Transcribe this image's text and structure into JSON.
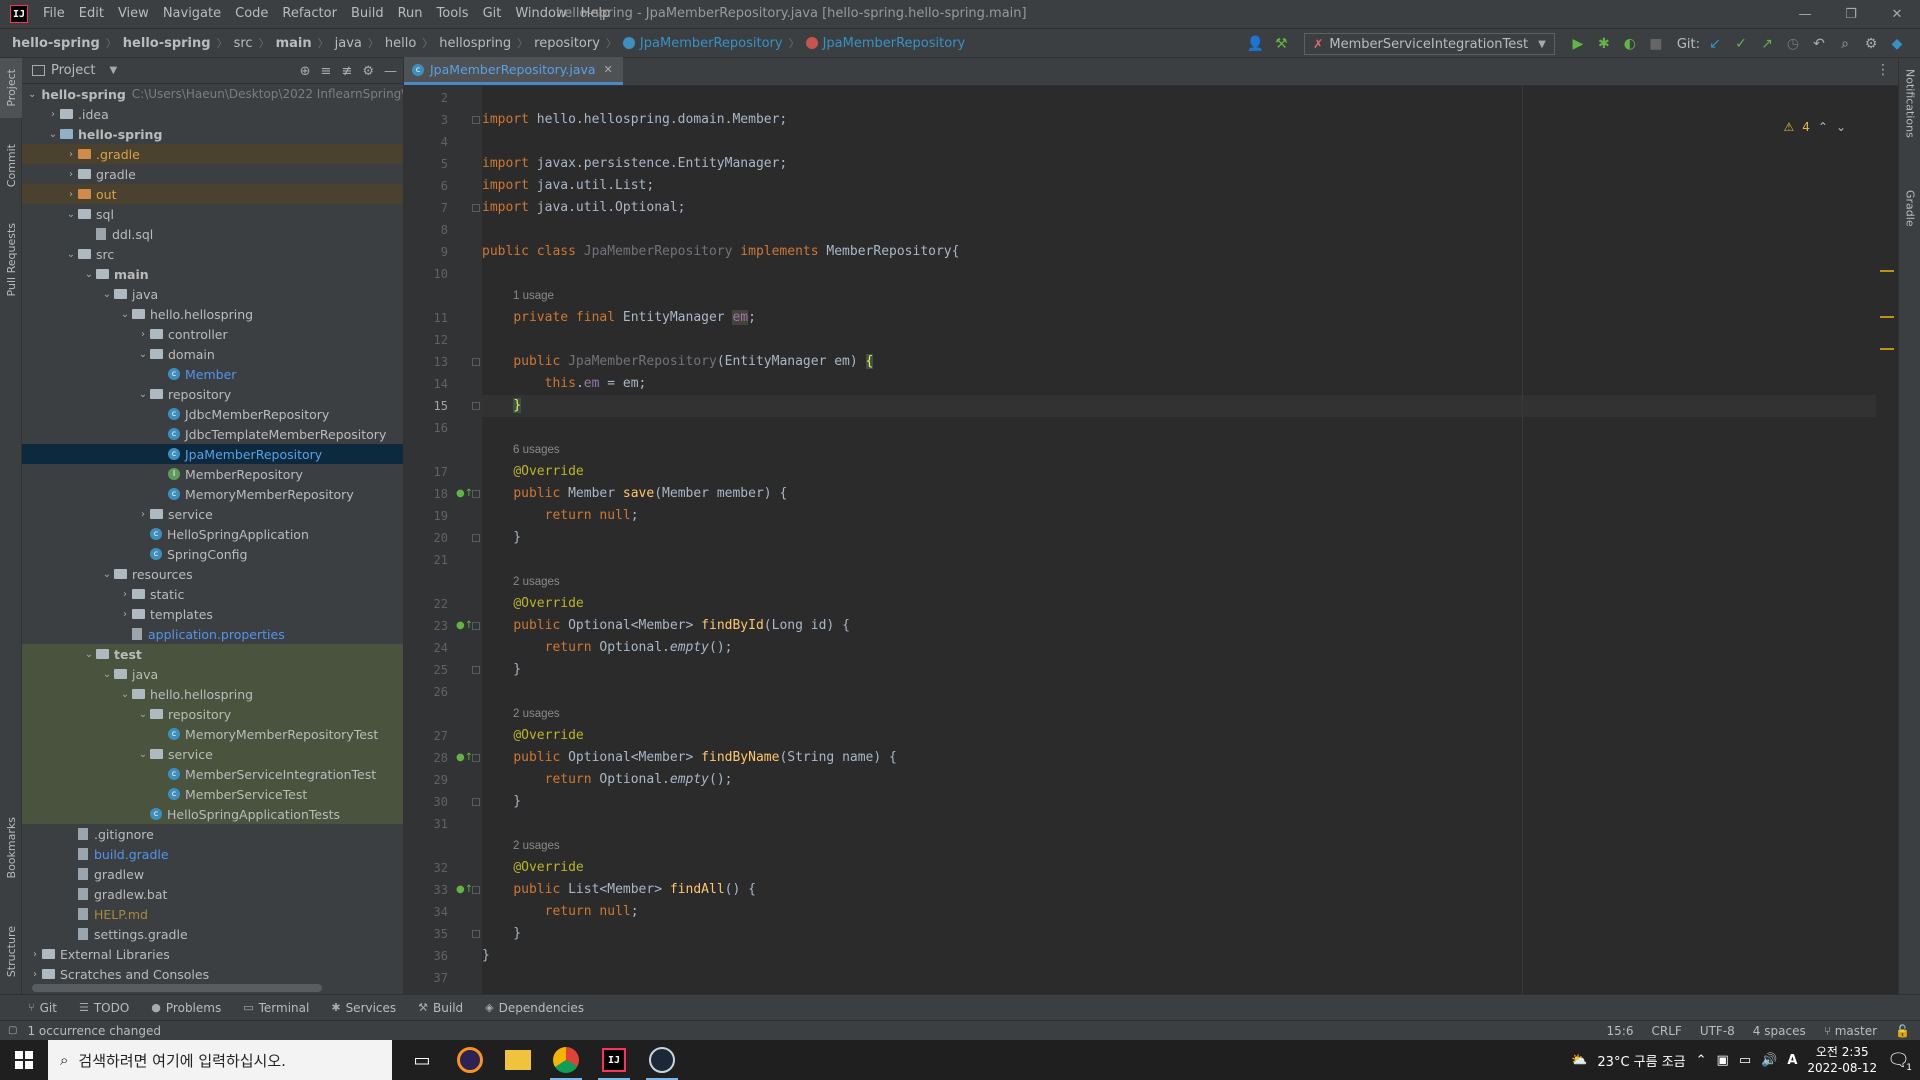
{
  "menu": {
    "logo": "IJ",
    "items": [
      "File",
      "Edit",
      "View",
      "Navigate",
      "Code",
      "Refactor",
      "Build",
      "Run",
      "Tools",
      "Git",
      "Window",
      "Help"
    ]
  },
  "window_title": "hello-spring - JpaMemberRepository.java [hello-spring.hello-spring.main]",
  "breadcrumb": [
    "hello-spring",
    "hello-spring",
    "src",
    "main",
    "java",
    "hello",
    "hellospring",
    "repository",
    "JpaMemberRepository",
    "JpaMemberRepository"
  ],
  "run_config": "MemberServiceIntegrationTest",
  "git_label": "Git:",
  "left_tabs": [
    "Project",
    "Commit",
    "Pull Requests",
    "Bookmarks",
    "Structure"
  ],
  "right_tabs": [
    "Notifications",
    "Gradle"
  ],
  "project_panel": {
    "title": "Project",
    "root_path": "C:\\Users\\Haeun\\Desktop\\2022 InflearnSpring\\"
  },
  "tree": [
    {
      "label": "hello-spring",
      "depth": 0,
      "type": "module",
      "arrow": "open",
      "bold": true
    },
    {
      "label": ".idea",
      "depth": 1,
      "type": "folder",
      "arrow": "closed"
    },
    {
      "label": "hello-spring",
      "depth": 1,
      "type": "module",
      "arrow": "open",
      "bold": true
    },
    {
      "label": ".gradle",
      "depth": 2,
      "type": "folder-orange",
      "arrow": "closed",
      "color": "orange",
      "hl": "brown"
    },
    {
      "label": "gradle",
      "depth": 2,
      "type": "folder",
      "arrow": "closed"
    },
    {
      "label": "out",
      "depth": 2,
      "type": "folder-orange",
      "arrow": "closed",
      "color": "orange",
      "hl": "brown"
    },
    {
      "label": "sql",
      "depth": 2,
      "type": "folder",
      "arrow": "open"
    },
    {
      "label": "ddl.sql",
      "depth": 3,
      "type": "file",
      "arrow": "none"
    },
    {
      "label": "src",
      "depth": 2,
      "type": "folder",
      "arrow": "open"
    },
    {
      "label": "main",
      "depth": 3,
      "type": "folder",
      "arrow": "open",
      "bold": true
    },
    {
      "label": "java",
      "depth": 4,
      "type": "folder",
      "arrow": "open"
    },
    {
      "label": "hello.hellospring",
      "depth": 5,
      "type": "folder",
      "arrow": "open"
    },
    {
      "label": "controller",
      "depth": 6,
      "type": "folder",
      "arrow": "closed"
    },
    {
      "label": "domain",
      "depth": 6,
      "type": "folder",
      "arrow": "open"
    },
    {
      "label": "Member",
      "depth": 7,
      "type": "class",
      "arrow": "none",
      "color": "blue"
    },
    {
      "label": "repository",
      "depth": 6,
      "type": "folder",
      "arrow": "open"
    },
    {
      "label": "JdbcMemberRepository",
      "depth": 7,
      "type": "class",
      "arrow": "none"
    },
    {
      "label": "JdbcTemplateMemberRepository",
      "depth": 7,
      "type": "class",
      "arrow": "none"
    },
    {
      "label": "JpaMemberRepository",
      "depth": 7,
      "type": "class",
      "arrow": "none",
      "color": "selected",
      "hl": "selected"
    },
    {
      "label": "MemberRepository",
      "depth": 7,
      "type": "interface",
      "arrow": "none"
    },
    {
      "label": "MemoryMemberRepository",
      "depth": 7,
      "type": "class",
      "arrow": "none"
    },
    {
      "label": "service",
      "depth": 6,
      "type": "folder",
      "arrow": "closed"
    },
    {
      "label": "HelloSpringApplication",
      "depth": 6,
      "type": "class",
      "arrow": "none"
    },
    {
      "label": "SpringConfig",
      "depth": 6,
      "type": "class",
      "arrow": "none"
    },
    {
      "label": "resources",
      "depth": 4,
      "type": "folder",
      "arrow": "open"
    },
    {
      "label": "static",
      "depth": 5,
      "type": "folder",
      "arrow": "closed"
    },
    {
      "label": "templates",
      "depth": 5,
      "type": "folder",
      "arrow": "closed"
    },
    {
      "label": "application.properties",
      "depth": 5,
      "type": "file",
      "arrow": "none",
      "color": "blue"
    },
    {
      "label": "test",
      "depth": 3,
      "type": "folder",
      "arrow": "open",
      "bold": true,
      "hl": "green"
    },
    {
      "label": "java",
      "depth": 4,
      "type": "folder",
      "arrow": "open",
      "hl": "green"
    },
    {
      "label": "hello.hellospring",
      "depth": 5,
      "type": "folder",
      "arrow": "open",
      "hl": "green"
    },
    {
      "label": "repository",
      "depth": 6,
      "type": "folder",
      "arrow": "open",
      "hl": "green"
    },
    {
      "label": "MemoryMemberRepositoryTest",
      "depth": 7,
      "type": "class",
      "arrow": "none",
      "hl": "green"
    },
    {
      "label": "service",
      "depth": 6,
      "type": "folder",
      "arrow": "open",
      "hl": "green"
    },
    {
      "label": "MemberServiceIntegrationTest",
      "depth": 7,
      "type": "class",
      "arrow": "none",
      "hl": "green"
    },
    {
      "label": "MemberServiceTest",
      "depth": 7,
      "type": "class",
      "arrow": "none",
      "hl": "green"
    },
    {
      "label": "HelloSpringApplicationTests",
      "depth": 6,
      "type": "class",
      "arrow": "none",
      "hl": "green"
    },
    {
      "label": ".gitignore",
      "depth": 2,
      "type": "file",
      "arrow": "none"
    },
    {
      "label": "build.gradle",
      "depth": 2,
      "type": "file",
      "arrow": "none",
      "color": "blue"
    },
    {
      "label": "gradlew",
      "depth": 2,
      "type": "file",
      "arrow": "none"
    },
    {
      "label": "gradlew.bat",
      "depth": 2,
      "type": "file",
      "arrow": "none"
    },
    {
      "label": "HELP.md",
      "depth": 2,
      "type": "file",
      "arrow": "none",
      "color": "olive"
    },
    {
      "label": "settings.gradle",
      "depth": 2,
      "type": "file",
      "arrow": "none"
    },
    {
      "label": "External Libraries",
      "depth": 0,
      "type": "folder",
      "arrow": "closed"
    },
    {
      "label": "Scratches and Consoles",
      "depth": 0,
      "type": "folder",
      "arrow": "closed"
    }
  ],
  "editor": {
    "tab_label": "JpaMemberRepository.java",
    "warnings": "4",
    "current_line": "15",
    "lines": [
      {
        "n": "2",
        "html": ""
      },
      {
        "n": "3",
        "html": "<span class=\"kw\">import</span> hello.hellospring.domain.Member;"
      },
      {
        "n": "4",
        "html": ""
      },
      {
        "n": "5",
        "html": "<span class=\"kw\">import</span> javax.persistence.EntityManager;"
      },
      {
        "n": "6",
        "html": "<span class=\"kw\">import</span> java.util.List;"
      },
      {
        "n": "7",
        "html": "<span class=\"kw\">import</span> java.util.Optional;"
      },
      {
        "n": "8",
        "html": ""
      },
      {
        "n": "9",
        "html": "<span class=\"kw\">public class</span> <span class=\"gray\">JpaMemberRepository</span> <span class=\"kw\">implements</span> MemberRepository{"
      },
      {
        "n": "10",
        "html": ""
      },
      {
        "usage": "1 usage"
      },
      {
        "n": "11",
        "html": "    <span class=\"kw\">private final</span> EntityManager <span class=\"fld hlbox\">em</span>;"
      },
      {
        "n": "12",
        "html": ""
      },
      {
        "n": "13",
        "html": "    <span class=\"kw\">public</span> <span class=\"gray\">JpaMemberRepository</span>(EntityManager em) <span class=\"brace\">{</span>"
      },
      {
        "n": "14",
        "html": "        <span class=\"kw\">this</span>.<span class=\"fld\">em</span> = em;"
      },
      {
        "n": "15",
        "html": "    <span class=\"brace\">}</span>"
      },
      {
        "n": "16",
        "html": ""
      },
      {
        "usage": "6 usages"
      },
      {
        "n": "17",
        "html": "    <span class=\"ann\">@Override</span>"
      },
      {
        "n": "18",
        "html": "    <span class=\"kw\">public</span> Member <span class=\"fn\">save</span>(Member member) {"
      },
      {
        "n": "19",
        "html": "        <span class=\"kw\">return null</span>;"
      },
      {
        "n": "20",
        "html": "    }"
      },
      {
        "n": "21",
        "html": ""
      },
      {
        "usage": "2 usages"
      },
      {
        "n": "22",
        "html": "    <span class=\"ann\">@Override</span>"
      },
      {
        "n": "23",
        "html": "    <span class=\"kw\">public</span> Optional&lt;Member&gt; <span class=\"fn\">findById</span>(Long id) {"
      },
      {
        "n": "24",
        "html": "        <span class=\"kw\">return</span> Optional.<span class=\"ital\">empty</span>();"
      },
      {
        "n": "25",
        "html": "    }"
      },
      {
        "n": "26",
        "html": ""
      },
      {
        "usage": "2 usages"
      },
      {
        "n": "27",
        "html": "    <span class=\"ann\">@Override</span>"
      },
      {
        "n": "28",
        "html": "    <span class=\"kw\">public</span> Optional&lt;Member&gt; <span class=\"fn\">findByName</span>(String name) {"
      },
      {
        "n": "29",
        "html": "        <span class=\"kw\">return</span> Optional.<span class=\"ital\">empty</span>();"
      },
      {
        "n": "30",
        "html": "    }"
      },
      {
        "n": "31",
        "html": ""
      },
      {
        "usage": "2 usages"
      },
      {
        "n": "32",
        "html": "    <span class=\"ann\">@Override</span>"
      },
      {
        "n": "33",
        "html": "    <span class=\"kw\">public</span> List&lt;Member&gt; <span class=\"fn\">findAll</span>() {"
      },
      {
        "n": "34",
        "html": "        <span class=\"kw\">return null</span>;"
      },
      {
        "n": "35",
        "html": "    }"
      },
      {
        "n": "36",
        "html": "}"
      },
      {
        "n": "37",
        "html": ""
      }
    ]
  },
  "bottom_tools": [
    {
      "icon": "git-icon",
      "glyph": "⑂",
      "label": "Git"
    },
    {
      "icon": "todo-icon",
      "glyph": "☰",
      "label": "TODO"
    },
    {
      "icon": "problems-icon",
      "glyph": "●",
      "label": "Problems"
    },
    {
      "icon": "terminal-icon",
      "glyph": "▭",
      "label": "Terminal"
    },
    {
      "icon": "services-icon",
      "glyph": "✱",
      "label": "Services"
    },
    {
      "icon": "build-icon",
      "glyph": "⚒",
      "label": "Build"
    },
    {
      "icon": "dependencies-icon",
      "glyph": "◈",
      "label": "Dependencies"
    }
  ],
  "status": {
    "message": "1 occurrence changed",
    "position": "15:6",
    "line_sep": "CRLF",
    "encoding": "UTF-8",
    "indent": "4 spaces",
    "branch": "master"
  },
  "taskbar": {
    "search_placeholder": "검색하려면 여기에 입력하십시오.",
    "weather": "23°C 구름 조금",
    "ime": "A",
    "time": "오전 2:35",
    "date": "2022-08-12",
    "notif_count": "1"
  },
  "colors": {
    "accent": "#4a88c7",
    "keyword": "#cc7832",
    "annotation": "#bbb529",
    "method": "#ffc66d",
    "field": "#9876aa"
  }
}
